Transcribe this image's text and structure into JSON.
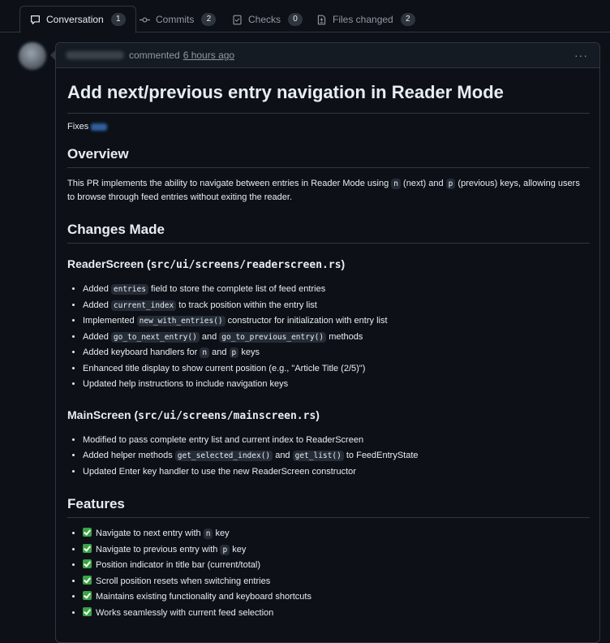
{
  "tabs": [
    {
      "label": "Conversation",
      "count": "1"
    },
    {
      "label": "Commits",
      "count": "2"
    },
    {
      "label": "Checks",
      "count": "0"
    },
    {
      "label": "Files changed",
      "count": "2"
    }
  ],
  "comment": {
    "action": "commented",
    "time": "6 hours ago",
    "menu": "···"
  },
  "pr": {
    "title": "Add next/previous entry navigation in Reader Mode",
    "fixes_label": "Fixes",
    "overview_heading": "Overview",
    "overview_text": {
      "t1": "This PR implements the ability to navigate between entries in Reader Mode using ",
      "c1": "n",
      "t2": " (next) and ",
      "c2": "p",
      "t3": " (previous) keys, allowing users to browse through feed entries without exiting the reader."
    },
    "changes_heading": "Changes Made",
    "reader": {
      "heading": "ReaderScreen (",
      "path": "src/ui/screens/readerscreen.rs",
      "close": ")",
      "items": [
        {
          "t1": "Added ",
          "c1": "entries",
          "t2": " field to store the complete list of feed entries"
        },
        {
          "t1": "Added ",
          "c1": "current_index",
          "t2": " to track position within the entry list"
        },
        {
          "t1": "Implemented ",
          "c1": "new_with_entries()",
          "t2": " constructor for initialization with entry list"
        },
        {
          "t1": "Added ",
          "c1": "go_to_next_entry()",
          "t2": " and ",
          "c2": "go_to_previous_entry()",
          "t3": " methods"
        },
        {
          "t1": "Added keyboard handlers for ",
          "c1": "n",
          "t2": " and ",
          "c2": "p",
          "t3": " keys"
        },
        {
          "t1": "Enhanced title display to show current position (e.g., \"Article Title (2/5)\")"
        },
        {
          "t1": "Updated help instructions to include navigation keys"
        }
      ]
    },
    "main": {
      "heading": "MainScreen (",
      "path": "src/ui/screens/mainscreen.rs",
      "close": ")",
      "items": [
        {
          "t1": "Modified to pass complete entry list and current index to ReaderScreen"
        },
        {
          "t1": "Added helper methods ",
          "c1": "get_selected_index()",
          "t2": " and ",
          "c2": "get_list()",
          "t3": " to FeedEntryState"
        },
        {
          "t1": "Updated Enter key handler to use the new ReaderScreen constructor"
        }
      ]
    },
    "features_heading": "Features",
    "features": [
      {
        "t1": "Navigate to next entry with ",
        "c1": "n",
        "t2": " key"
      },
      {
        "t1": "Navigate to previous entry with ",
        "c1": "p",
        "t2": " key"
      },
      {
        "t1": "Position indicator in title bar (current/total)"
      },
      {
        "t1": "Scroll position resets when switching entries"
      },
      {
        "t1": "Maintains existing functionality and keyboard shortcuts"
      },
      {
        "t1": "Works seamlessly with current feed selection"
      }
    ]
  }
}
